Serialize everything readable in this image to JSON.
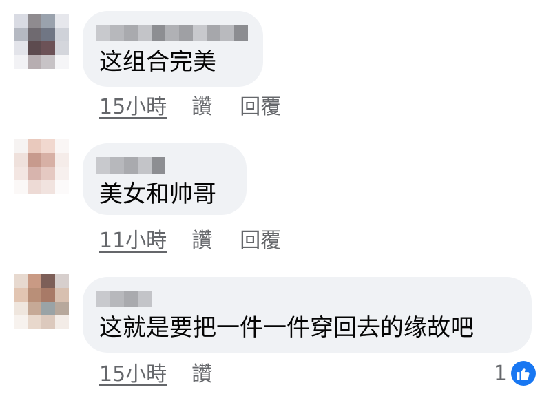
{
  "comments": [
    {
      "text": "这组合完美",
      "time": "15小時",
      "like": "讚",
      "reply": "回覆",
      "avatar_colors": [
        "#d9dbe3",
        "#8f8b8f",
        "#9aa2ad",
        "#e6e7ec",
        "#b5b9c2",
        "#6f6a70",
        "#707684",
        "#cfd2d9",
        "#e3e4ea",
        "#5d4b4f",
        "#6c5257",
        "#d4d6dc",
        "#f2f2f5",
        "#b7aeb1",
        "#c7c3c6",
        "#f5f5f7"
      ]
    },
    {
      "text": "美女和帅哥",
      "time": "11小時",
      "like": "讚",
      "reply": "回覆",
      "avatar_colors": [
        "#f6f3f2",
        "#e9c9bd",
        "#f1d8cf",
        "#faf6f5",
        "#efe1dc",
        "#c79a8d",
        "#d7b0a5",
        "#f5ece9",
        "#f3e6e2",
        "#d7b4ad",
        "#e5c9c2",
        "#f7f0ee",
        "#fbf8f7",
        "#eddad5",
        "#f1e3df",
        "#fcfafa"
      ]
    },
    {
      "text": "这就是要把一件一件穿回去的缘故吧",
      "time": "15小時",
      "like": "讚",
      "reaction_count": "1",
      "avatar_colors": [
        "#e7d9cf",
        "#c99a84",
        "#7d5f58",
        "#d7cfcd",
        "#e2c5b2",
        "#b98f78",
        "#a87a67",
        "#d8c0b0",
        "#efe6de",
        "#c6a996",
        "#9aa3a6",
        "#b7a89c",
        "#f7f2ee",
        "#e8d8cc",
        "#dcc9bd",
        "#f3ece7"
      ]
    }
  ],
  "name_blur_colors": [
    "#c8c9cd",
    "#b7b8bc",
    "#a9aaae",
    "#c3c4c8",
    "#8d8e92",
    "#b0b1b5",
    "#9fa0a4",
    "#c8c9cd",
    "#a6a7ab",
    "#b9babe",
    "#8c8d91"
  ],
  "colors": {
    "bubble": "#f0f2f5",
    "text": "#050505",
    "meta": "#65676b",
    "like_badge": "#1877f2"
  }
}
